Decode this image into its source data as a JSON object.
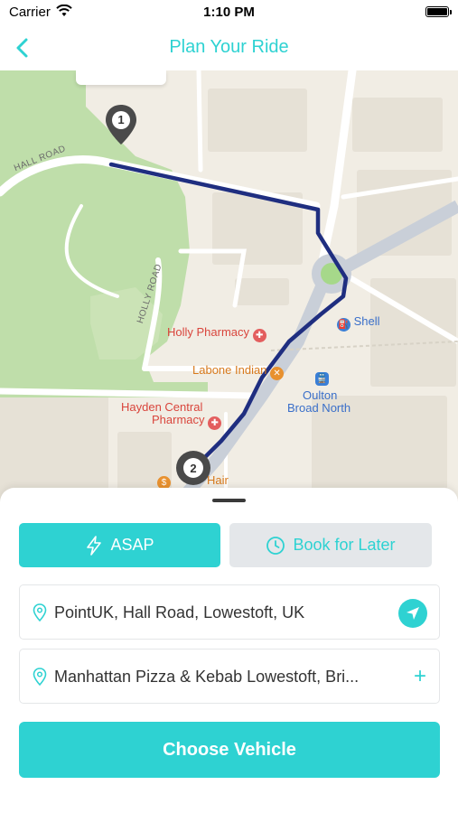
{
  "status_bar": {
    "carrier": "Carrier",
    "time": "1:10 PM"
  },
  "nav": {
    "title": "Plan Your Ride",
    "back_icon": "chevron-left-icon"
  },
  "map": {
    "roads": {
      "hall_road": "HALL ROAD",
      "holly_road": "HOLLY ROAD"
    },
    "places": {
      "holly_pharmacy": "Holly Pharmacy",
      "labone_indian": "Labone Indian",
      "shell": "Shell",
      "oulton_broad_north_line1": "Oulton",
      "oulton_broad_north_line2": "Broad North",
      "hayden_line1": "Hayden Central",
      "hayden_line2": "Pharmacy",
      "hair_partial": "Hair"
    },
    "markers": {
      "start": "1",
      "end": "2"
    },
    "route_color": "#1f2e80"
  },
  "ride_type": {
    "asap": "ASAP",
    "later": "Book for Later"
  },
  "pickup": {
    "value": "PointUK, Hall Road, Lowestoft, UK"
  },
  "dropoff": {
    "value": "Manhattan Pizza & Kebab Lowestoft, Bri...",
    "add_symbol": "+"
  },
  "action": {
    "label": "Choose Vehicle"
  },
  "colors": {
    "accent": "#2ed2d2",
    "secondary_bg": "#e4e7ea"
  }
}
